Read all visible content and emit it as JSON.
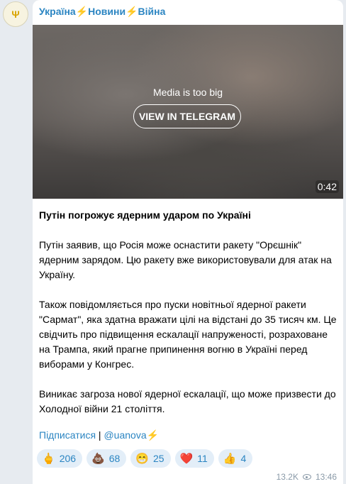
{
  "channel": {
    "name_parts": [
      "Україна",
      "⚡",
      "Новини",
      "⚡",
      "Війна"
    ]
  },
  "media": {
    "message": "Media is too big",
    "button_label": "VIEW IN TELEGRAM",
    "duration": "0:42"
  },
  "post": {
    "title": "Путін погрожує ядерним ударом по Україні",
    "paragraphs": [
      "Путін заявив, що Росія може оснастити ракету \"Орєшнік\" ядерним зарядом. Цю ракету вже використовували для атак на Україну.",
      "Також повідомляється про пуски новітньої ядерної ракети \"Сармат\", яка здатна вражати цілі на відстані до 35 тисяч км. Це свідчить про підвищення ескалації напруженості, розраховане на Трампа, який прагне припинення вогню в Україні перед виборами у Конгрес.",
      "Виникає загроза нової ядерної ескалації, що може призвести до Холодної війни 21 століття."
    ]
  },
  "footer": {
    "subscribe": "Підписатися",
    "separator": " | ",
    "handle": "@uanova",
    "handle_bolt": "⚡"
  },
  "reactions": [
    {
      "emoji": "🖕",
      "count": "206"
    },
    {
      "emoji": "💩",
      "count": "68"
    },
    {
      "emoji": "😁",
      "count": "25"
    },
    {
      "emoji": "❤️",
      "count": "11"
    },
    {
      "emoji": "👍",
      "count": "4"
    }
  ],
  "meta": {
    "views": "13.2K",
    "time": "13:46"
  },
  "colors": {
    "link": "#2b85c2",
    "bolt": "#f2c200",
    "reaction_bg": "#e3eef8"
  }
}
